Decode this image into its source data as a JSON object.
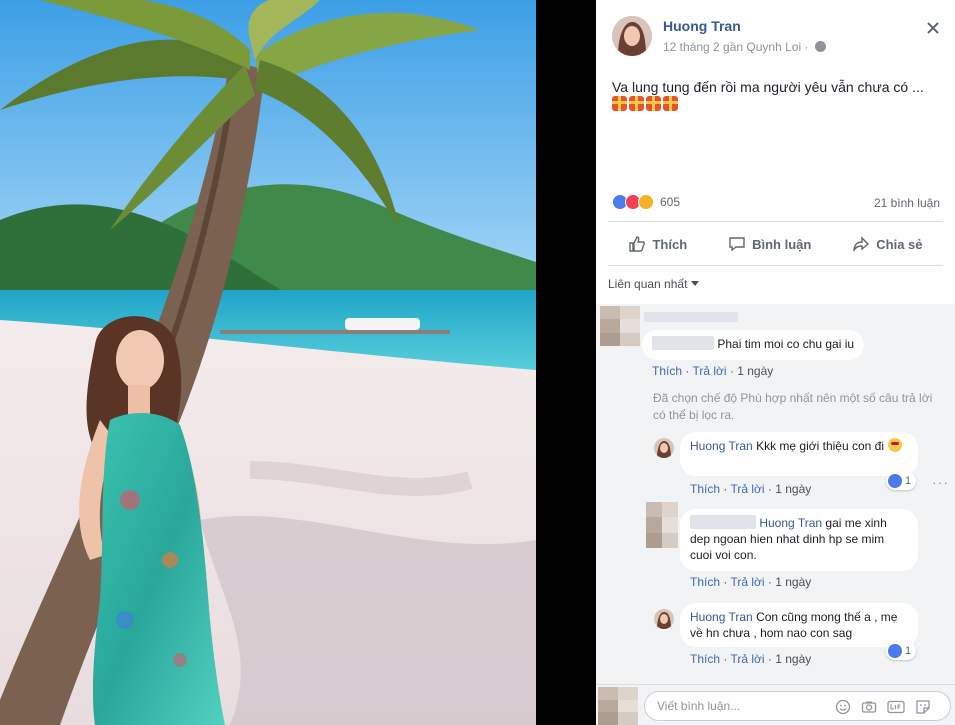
{
  "post": {
    "author": "Huong Tran",
    "meta": "12 tháng 2 gần Quynh Loi ·",
    "text": "Va lung tung đến rồi ma người yêu vẫn chưa có ...",
    "reaction_count": "605",
    "comment_count": "21 bình luận"
  },
  "actions": {
    "like": "Thích",
    "comment": "Bình luận",
    "share": "Chia sẻ"
  },
  "sort_label": "Liên quan nhất",
  "comments": [
    {
      "author": "",
      "text": "Phai tim moi co chu gai iu",
      "like_label": "Thích",
      "reply_label": "Trả lời",
      "time": "1 ngày"
    }
  ],
  "filter_note": "Đã chọn chế độ Phù hợp nhất nên một số câu trả lời có thể bị lọc ra.",
  "replies": [
    {
      "author": "Huong Tran",
      "text": "Kkk mẹ giới thiệu con đi",
      "like_label": "Thích",
      "reply_label": "Trả lời",
      "time": "1 ngày",
      "likes": "1"
    },
    {
      "author": "Huong Tran",
      "text_prefix": "gai me xinh dep ngoan hien nhat dinh hp se mim cuoi voi con.",
      "like_label": "Thích",
      "reply_label": "Trả lời",
      "time": "1 ngày"
    },
    {
      "author": "Huong Tran",
      "text": "Con cũng mong thế a , mẹ về hn chưa , hom nao con sag",
      "like_label": "Thích",
      "reply_label": "Trả lời",
      "time": "1 ngày",
      "likes": "1"
    }
  ],
  "reply_box": {
    "placeholder": "Viết bình luận..."
  },
  "icons": [
    "close-icon",
    "globe-icon",
    "like-icon",
    "comment-icon",
    "share-icon",
    "emoji-icon",
    "camera-icon",
    "gif-icon",
    "sticker-icon",
    "more-icon"
  ],
  "colors": {
    "link": "#385898",
    "action_link": "#4267b2",
    "like_blue": "#4b7bec",
    "love_red": "#f33e58",
    "haha_yellow": "#f7b125",
    "comment_bg": "#f2f3f5"
  }
}
